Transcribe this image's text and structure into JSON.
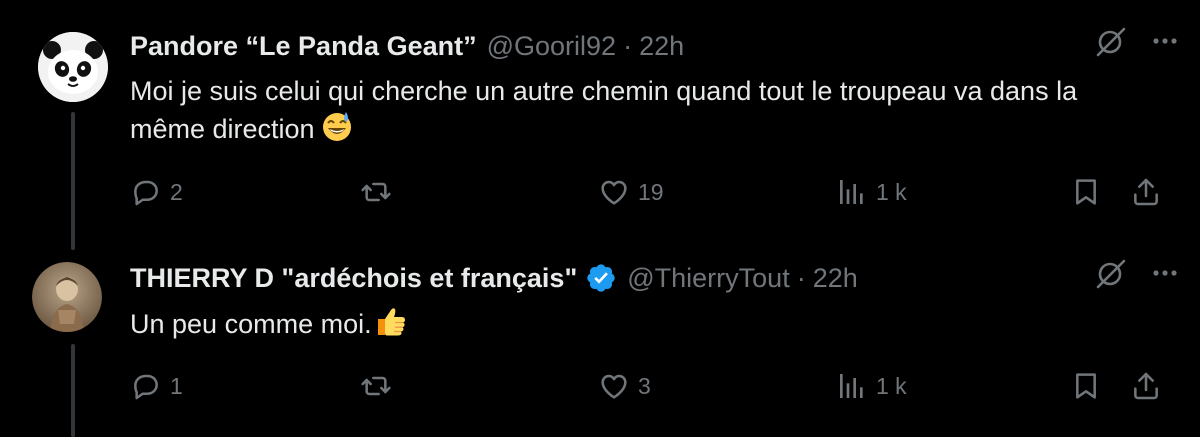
{
  "tweets": [
    {
      "name": "Pandore “Le Panda Geant”",
      "handle": "@Gooril92",
      "separator": "·",
      "time": "22h",
      "text": "Moi je suis celui qui cherche un autre chemin quand tout le troupeau va dans la même direction",
      "emoji": "sweat-smile-emoji",
      "verified": false,
      "avatar": "panda-avatar",
      "replies": "2",
      "retweets": "",
      "likes": "19",
      "views": "1 k"
    },
    {
      "name": "THIERRY D \"ardéchois et français\"",
      "handle": "@ThierryTout",
      "separator": "·",
      "time": "22h",
      "text": "Un peu comme moi.",
      "emoji": "thumbs-up-emoji",
      "verified": true,
      "avatar": "child-photo-avatar",
      "replies": "1",
      "retweets": "",
      "likes": "3",
      "views": "1 k"
    }
  ],
  "colors": {
    "background": "#000000",
    "text": "#e7e9ea",
    "muted": "#71767b",
    "verified": "#1d9bf0",
    "thread_line": "#333639"
  }
}
